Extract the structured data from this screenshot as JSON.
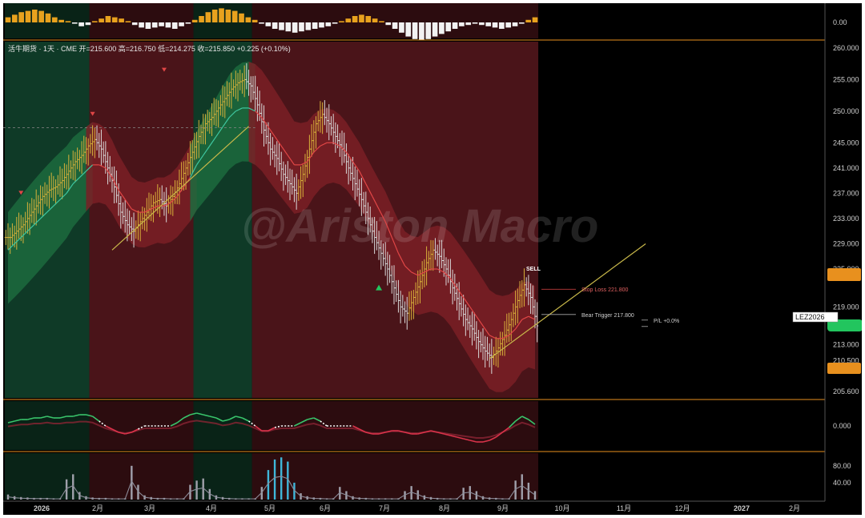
{
  "header": {
    "symbol_line": "活牛期货 · 1天 · CME",
    "open_label": "开",
    "open": "215.600",
    "high_label": "高",
    "high": "216.750",
    "low_label": "低",
    "low": "214.275",
    "close_label": "收",
    "close": "215.850",
    "change": "+0.225 (+0.10%)"
  },
  "watermark": "@Ariston Macro",
  "annotations": {
    "stop_loss": "Stop Loss 221.800",
    "bear_trigger": "Bear Trigger 217.800",
    "pl": "P/L +0.0%",
    "sell": "SELL",
    "ticker_tag": "LEZ2026"
  },
  "colors": {
    "bull_zone": "#0f3a27",
    "bear_zone": "#4a1419",
    "bull_band": "#1c6b3e",
    "bear_band": "#7a1f26",
    "price_up": "#d8b13a",
    "price_down": "#d9d9d9",
    "ma_bull": "#3fc7a0",
    "ma_bear": "#e04646",
    "trend": "#c8b84a",
    "osc_green": "#39c46b",
    "osc_red": "#d9334a",
    "hist_pos": "#e8a21e",
    "vol_gray": "#a0a0ab",
    "vol_cyan": "#3fb6d9",
    "tag_orange": "#e8901e",
    "tag_green": "#22c55e"
  },
  "chart_data": [
    {
      "type": "bar",
      "name": "top-histogram",
      "y_ticks": [
        "0.00"
      ],
      "bars": [
        0.4,
        0.6,
        0.8,
        0.9,
        1.0,
        0.9,
        0.7,
        0.4,
        0.2,
        0.1,
        -0.1,
        -0.3,
        -0.2,
        0.1,
        0.3,
        0.5,
        0.4,
        0.3,
        0.1,
        -0.2,
        -0.4,
        -0.5,
        -0.4,
        -0.3,
        -0.4,
        -0.5,
        -0.3,
        -0.1,
        0.2,
        0.5,
        0.8,
        1.0,
        1.1,
        1.0,
        0.9,
        0.7,
        0.4,
        0.2,
        -0.1,
        -0.3,
        -0.5,
        -0.6,
        -0.7,
        -0.8,
        -0.7,
        -0.6,
        -0.5,
        -0.4,
        -0.3,
        -0.1,
        0.1,
        0.3,
        0.5,
        0.6,
        0.5,
        0.3,
        0.1,
        -0.2,
        -0.5,
        -0.8,
        -1.1,
        -1.3,
        -1.4,
        -1.3,
        -1.1,
        -0.9,
        -0.7,
        -0.5,
        -0.3,
        -0.2,
        -0.1,
        -0.2,
        -0.3,
        -0.4,
        -0.5,
        -0.4,
        -0.3,
        -0.1,
        0.2,
        0.4
      ]
    },
    {
      "type": "line",
      "name": "price",
      "y_ticks": [
        "260.000",
        "255.000",
        "250.000",
        "245.000",
        "241.000",
        "237.000",
        "233.000",
        "229.000",
        "225.000",
        "219.000",
        "213.000",
        "210.500",
        "205.600"
      ],
      "x_ticks": [
        "2026",
        "2月",
        "3月",
        "4月",
        "5月",
        "6月",
        "7月",
        "8月",
        "9月",
        "10月",
        "11月",
        "12月",
        "2027",
        "2月"
      ],
      "ylim": [
        205.6,
        260
      ],
      "zones": [
        {
          "state": "bull",
          "from": 0.0,
          "to": 0.5
        },
        {
          "state": "bear",
          "from": 0.5,
          "to": 1.0
        }
      ],
      "close": [
        230.0,
        231.0,
        232.0,
        233.5,
        235.0,
        236.5,
        237.5,
        238.0,
        239.0,
        240.5,
        242.0,
        243.0,
        244.5,
        245.5,
        244.0,
        241.0,
        238.0,
        234.0,
        232.0,
        231.0,
        232.5,
        234.0,
        235.5,
        236.0,
        235.0,
        236.5,
        238.5,
        241.0,
        243.5,
        246.0,
        248.0,
        249.0,
        250.5,
        252.0,
        253.5,
        254.5,
        255.0,
        254.0,
        251.0,
        247.0,
        244.0,
        242.5,
        240.0,
        238.5,
        237.0,
        240.0,
        244.0,
        248.0,
        249.5,
        248.0,
        246.0,
        244.0,
        241.0,
        238.5,
        236.0,
        233.0,
        230.0,
        227.5,
        225.0,
        222.0,
        219.0,
        218.0,
        220.5,
        223.0,
        226.0,
        228.0,
        227.0,
        225.0,
        222.0,
        219.5,
        217.0,
        215.5,
        213.5,
        212.0,
        211.0,
        212.5,
        214.5,
        217.0,
        220.0,
        222.5,
        220.5,
        216.0
      ],
      "fast_ma": [
        228.0,
        229.0,
        230.0,
        231.0,
        232.0,
        233.0,
        234.0,
        235.0,
        236.0,
        237.0,
        238.5,
        239.5,
        240.5,
        241.5,
        241.5,
        241.0,
        239.5,
        237.5,
        236.0,
        234.5,
        234.0,
        234.0,
        234.5,
        235.0,
        235.0,
        235.5,
        236.5,
        238.0,
        239.5,
        241.5,
        243.0,
        244.5,
        246.0,
        247.5,
        249.0,
        250.0,
        250.5,
        250.5,
        250.0,
        249.0,
        247.5,
        246.0,
        244.5,
        243.0,
        241.5,
        241.5,
        242.0,
        243.5,
        244.5,
        245.0,
        245.0,
        244.5,
        243.5,
        242.0,
        240.5,
        238.5,
        236.5,
        234.5,
        232.5,
        230.0,
        227.5,
        225.5,
        224.5,
        224.0,
        224.5,
        225.0,
        225.0,
        224.5,
        223.5,
        222.0,
        220.5,
        219.0,
        217.5,
        216.0,
        214.5,
        214.0,
        214.0,
        214.5,
        215.5,
        217.0,
        217.5,
        217.0
      ],
      "stop_loss": 221.8,
      "bear_trigger": 217.8
    },
    {
      "type": "line",
      "name": "oscillator",
      "y_ticks": [
        "0.000"
      ],
      "values": [
        0.2,
        0.3,
        0.4,
        0.4,
        0.5,
        0.5,
        0.6,
        0.5,
        0.5,
        0.6,
        0.6,
        0.7,
        0.7,
        0.6,
        0.3,
        0.0,
        -0.2,
        -0.4,
        -0.5,
        -0.4,
        -0.2,
        0.0,
        0.0,
        0.0,
        0.0,
        0.0,
        0.2,
        0.5,
        0.7,
        0.8,
        0.7,
        0.6,
        0.5,
        0.3,
        0.4,
        0.6,
        0.5,
        0.3,
        0.0,
        -0.3,
        -0.3,
        -0.1,
        0.0,
        0.0,
        0.0,
        0.2,
        0.4,
        0.5,
        0.3,
        0.0,
        0.0,
        0.0,
        0.0,
        0.0,
        -0.2,
        -0.4,
        -0.5,
        -0.5,
        -0.4,
        -0.3,
        -0.3,
        -0.4,
        -0.5,
        -0.5,
        -0.4,
        -0.3,
        -0.4,
        -0.5,
        -0.6,
        -0.7,
        -0.8,
        -0.9,
        -1.0,
        -1.0,
        -0.9,
        -0.7,
        -0.4,
        -0.1,
        0.3,
        0.6,
        0.4,
        0.1
      ]
    },
    {
      "type": "bar",
      "name": "volume-spikes",
      "y_ticks": [
        "80.00",
        "40.00"
      ],
      "ylim": [
        0,
        110
      ],
      "values": [
        12,
        8,
        6,
        5,
        4,
        4,
        4,
        3,
        3,
        48,
        60,
        18,
        8,
        5,
        4,
        4,
        3,
        3,
        3,
        80,
        35,
        10,
        6,
        4,
        4,
        3,
        3,
        3,
        35,
        45,
        50,
        25,
        10,
        6,
        4,
        3,
        3,
        3,
        3,
        30,
        70,
        95,
        100,
        90,
        40,
        15,
        8,
        5,
        4,
        3,
        3,
        30,
        20,
        8,
        5,
        4,
        3,
        3,
        3,
        3,
        3,
        20,
        32,
        22,
        10,
        6,
        4,
        3,
        3,
        3,
        28,
        32,
        20,
        8,
        5,
        4,
        3,
        3,
        45,
        60,
        40,
        20
      ],
      "highlight_from": 40,
      "highlight_to": 44
    }
  ]
}
